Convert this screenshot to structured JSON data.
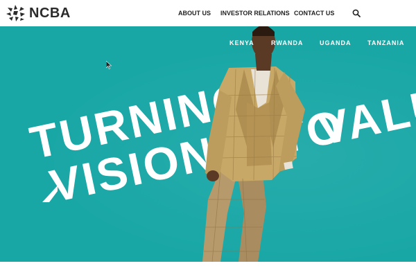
{
  "header": {
    "logo_text": "NCBA",
    "logo_icon": "ncba-starburst-icon",
    "nav": {
      "about": "ABOUT US",
      "investor_relations": "INVESTOR RELATIONS",
      "contact": "CONTACT US"
    },
    "search_icon": "search-icon"
  },
  "hero": {
    "countries": [
      "KENYA",
      "RWANDA",
      "UGANDA",
      "TANZANIA"
    ],
    "headline_line1": "TURNING",
    "headline_line2": "VISION INTO",
    "headline_line3": "VALU",
    "colors": {
      "background": "#19a7a6",
      "text": "#ffffff"
    }
  }
}
